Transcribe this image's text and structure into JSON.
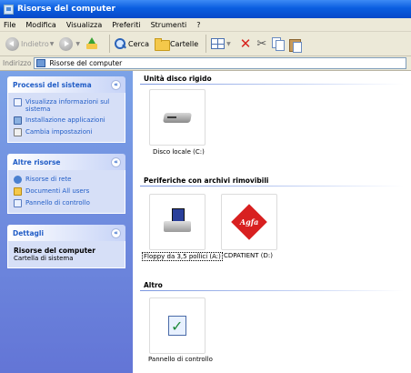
{
  "window": {
    "title": "Risorse del computer"
  },
  "menu": [
    "File",
    "Modifica",
    "Visualizza",
    "Preferiti",
    "Strumenti",
    "?"
  ],
  "toolbar": {
    "back": "Indietro",
    "search": "Cerca",
    "folders": "Cartelle"
  },
  "address": {
    "label": "Indirizzo",
    "value": "Risorse del computer"
  },
  "taskpane": {
    "system": {
      "title": "Processi del sistema",
      "tasks": [
        "Visualizza informazioni sul sistema",
        "Installazione applicazioni",
        "Cambia impostazioni"
      ]
    },
    "other": {
      "title": "Altre risorse",
      "tasks": [
        "Risorse di rete",
        "Documenti All users",
        "Pannello di controllo"
      ]
    },
    "details": {
      "title": "Dettagli",
      "name": "Risorse del computer",
      "type": "Cartella di sistema"
    }
  },
  "content": {
    "sections": [
      {
        "title": "Unità disco rigido",
        "items": [
          {
            "label": "Disco locale (C:)"
          }
        ]
      },
      {
        "title": "Periferiche con archivi rimovibili",
        "items": [
          {
            "label": "Floppy da 3,5 pollici (A:)"
          },
          {
            "label": "CDPATIENT (D:)",
            "logo_text": "Agfa"
          }
        ]
      },
      {
        "title": "Altro",
        "items": [
          {
            "label": "Pannello di controllo"
          }
        ]
      }
    ]
  },
  "colors": {
    "titlebar": "#0a5ee0",
    "taskpane_link": "#215dc6",
    "taskpane_bg": "#7ba2e7"
  }
}
